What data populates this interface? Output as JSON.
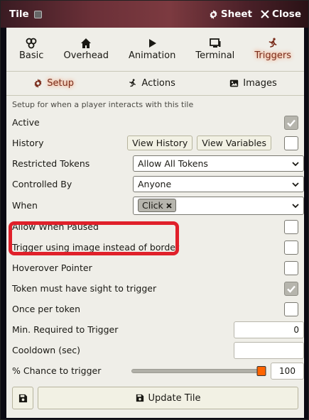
{
  "window": {
    "title": "Tile",
    "sheet_label": "Sheet",
    "close_label": "Close"
  },
  "tabs_primary": [
    {
      "label": "Basic",
      "icon": "dice-icon"
    },
    {
      "label": "Overhead",
      "icon": "home-icon"
    },
    {
      "label": "Animation",
      "icon": "play-icon"
    },
    {
      "label": "Terminal",
      "icon": "terminal-icon"
    },
    {
      "label": "Triggers",
      "icon": "running-icon",
      "active": true
    }
  ],
  "tabs_secondary": [
    {
      "label": "Setup",
      "icon": "gear-icon",
      "active": true
    },
    {
      "label": "Actions",
      "icon": "running-icon"
    },
    {
      "label": "Images",
      "icon": "image-icon"
    }
  ],
  "hint": "Setup for when a player interacts with this tile",
  "fields": {
    "active": {
      "label": "Active",
      "checked": true
    },
    "history": {
      "label": "History",
      "view_history": "View History",
      "view_variables": "View Variables",
      "checked": false
    },
    "restricted_tokens": {
      "label": "Restricted Tokens",
      "value": "Allow All Tokens"
    },
    "controlled_by": {
      "label": "Controlled By",
      "value": "Anyone"
    },
    "when": {
      "label": "When",
      "chip": "Click"
    },
    "allow_when_paused": {
      "label": "Allow When Paused",
      "checked": false
    },
    "trigger_image": {
      "label": "Trigger using image instead of border",
      "checked": false
    },
    "hoverover": {
      "label": "Hoverover Pointer",
      "checked": false
    },
    "sight": {
      "label": "Token must have sight to trigger",
      "checked": true
    },
    "once_per_token": {
      "label": "Once per token",
      "checked": false
    },
    "min_required": {
      "label": "Min. Required to Trigger",
      "value": "0"
    },
    "cooldown": {
      "label": "Cooldown (sec)",
      "value": ""
    },
    "chance": {
      "label": "% Chance to trigger",
      "value": "100",
      "percent": 100
    }
  },
  "footer": {
    "update_label": "Update Tile"
  },
  "colors": {
    "accent_active": "#7a2d1c",
    "highlight": "#e0202a",
    "slider_thumb": "#ff6400"
  }
}
